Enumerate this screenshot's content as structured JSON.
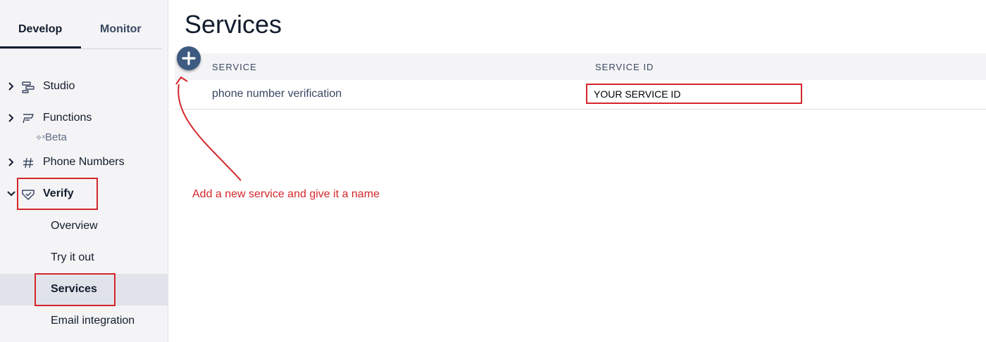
{
  "sidebar": {
    "tabs": {
      "develop": "Develop",
      "monitor": "Monitor"
    },
    "items": [
      {
        "label": "Studio",
        "icon": "studio-icon"
      },
      {
        "label": "Functions",
        "icon": "functions-icon",
        "badge": "Beta"
      },
      {
        "label": "Phone Numbers",
        "icon": "hash-icon"
      },
      {
        "label": "Verify",
        "icon": "verify-shield-icon",
        "expanded": true
      }
    ],
    "verify_sub": [
      {
        "label": "Overview"
      },
      {
        "label": "Try it out"
      },
      {
        "label": "Services",
        "active": true
      },
      {
        "label": "Email integration"
      }
    ]
  },
  "main": {
    "title": "Services",
    "columns": {
      "service": "SERVICE",
      "service_id": "SERVICE ID"
    },
    "rows": [
      {
        "service": "phone number verification",
        "service_id": "YOUR SERVICE ID"
      }
    ],
    "annotation": "Add a new service and give it a name"
  },
  "colors": {
    "highlight": "#d4262b",
    "add_button": "#3d5a80",
    "sidebar_bg": "#f4f4f6"
  }
}
